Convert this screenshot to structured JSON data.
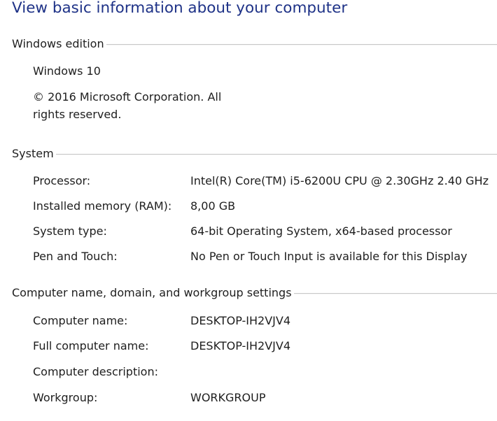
{
  "page": {
    "title": "View basic information about your computer"
  },
  "windows_edition": {
    "header": "Windows edition",
    "edition": "Windows 10",
    "copyright_line1": "© 2016 Microsoft Corporation. All",
    "copyright_line2": "rights reserved."
  },
  "system": {
    "header": "System",
    "rows": [
      {
        "label": "Processor:",
        "value": "Intel(R) Core(TM) i5-6200U CPU @ 2.30GHz   2.40 GHz"
      },
      {
        "label": "Installed memory (RAM):",
        "value": "8,00 GB"
      },
      {
        "label": "System type:",
        "value": "64-bit Operating System, x64-based processor"
      },
      {
        "label": "Pen and Touch:",
        "value": "No Pen or Touch Input is available for this Display"
      }
    ]
  },
  "computer_name": {
    "header": "Computer name, domain, and workgroup settings",
    "rows": [
      {
        "label": "Computer name:",
        "value": "DESKTOP-IH2VJV4"
      },
      {
        "label": "Full computer name:",
        "value": "DESKTOP-IH2VJV4"
      },
      {
        "label": "Computer description:",
        "value": ""
      },
      {
        "label": "Workgroup:",
        "value": "WORKGROUP"
      }
    ]
  }
}
